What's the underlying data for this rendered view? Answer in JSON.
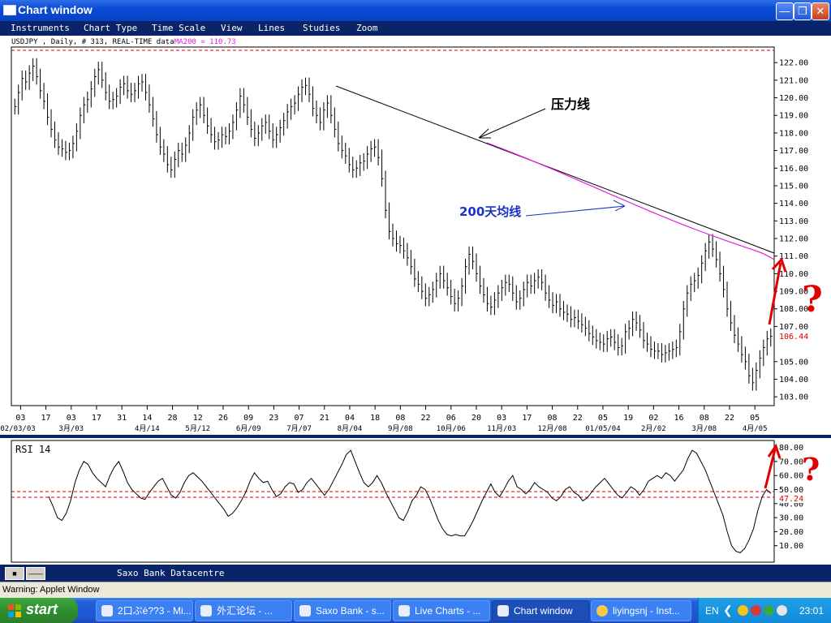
{
  "window": {
    "title": "Chart window"
  },
  "menu": [
    "Instruments",
    "Chart Type",
    "Time Scale",
    "View",
    "Lines",
    "Studies",
    "Zoom"
  ],
  "chart_header": {
    "info": "USDJPY , Daily, # 313, REAL-TIME data",
    "ma_label": ", MA200 = 110.73"
  },
  "annotations": {
    "resistance_line": "压力线",
    "ma200_label": "200天均线",
    "question_mark": "?"
  },
  "chart_data": [
    {
      "type": "line",
      "series": [
        {
          "name": "USDJPY",
          "values": [
            119.5,
            120.3,
            121.1,
            120.9,
            121.4,
            121.8,
            121.2,
            120.4,
            119.8,
            118.9,
            118.2,
            117.6,
            117.2,
            117.1,
            116.9,
            117.0,
            117.4,
            118.1,
            119.0,
            119.6,
            119.9,
            120.5,
            121.2,
            121.6,
            121.0,
            120.3,
            119.8,
            119.9,
            120.1,
            120.6,
            120.8,
            120.4,
            120.2,
            120.4,
            120.8,
            120.9,
            120.3,
            119.6,
            118.8,
            117.9,
            117.2,
            116.8,
            116.2,
            115.9,
            116.5,
            117.0,
            116.8,
            117.3,
            118.0,
            118.9,
            119.3,
            119.6,
            119.0,
            118.4,
            117.9,
            117.5,
            117.6,
            117.9,
            117.8,
            118.1,
            118.6,
            119.3,
            120.1,
            119.6,
            118.9,
            118.2,
            117.7,
            118.0,
            118.4,
            118.6,
            118.1,
            117.6,
            117.9,
            118.3,
            118.7,
            119.2,
            119.5,
            119.7,
            120.2,
            120.6,
            120.7,
            120.2,
            119.4,
            119.0,
            118.6,
            119.3,
            119.7,
            119.0,
            118.2,
            117.4,
            117.0,
            116.7,
            116.2,
            115.9,
            116.0,
            116.3,
            116.4,
            116.8,
            117.1,
            117.2,
            116.6,
            115.4,
            113.6,
            112.4,
            112.0,
            111.7,
            111.6,
            111.3,
            110.9,
            110.4,
            109.7,
            109.4,
            109.0,
            108.6,
            108.8,
            109.1,
            109.6,
            110.0,
            109.6,
            109.2,
            108.7,
            108.3,
            108.6,
            109.3,
            110.4,
            111.1,
            110.7,
            110.0,
            109.3,
            108.8,
            108.3,
            108.1,
            108.5,
            108.9,
            109.2,
            109.5,
            109.4,
            108.9,
            108.4,
            108.6,
            109.1,
            109.5,
            109.3,
            109.6,
            109.8,
            109.5,
            108.9,
            108.5,
            108.2,
            108.4,
            108.0,
            107.8,
            107.7,
            107.4,
            107.5,
            107.3,
            107.1,
            106.9,
            106.6,
            106.4,
            106.2,
            106.1,
            106.0,
            106.3,
            106.4,
            106.1,
            105.8,
            105.9,
            106.7,
            106.9,
            107.4,
            107.2,
            106.8,
            106.2,
            106.0,
            105.7,
            105.6,
            105.6,
            105.4,
            105.5,
            105.6,
            105.7,
            105.8,
            106.7,
            108.0,
            108.9,
            109.4,
            109.6,
            109.9,
            110.6,
            111.3,
            111.8,
            111.4,
            110.8,
            110.0,
            109.1,
            108.0,
            107.2,
            106.5,
            106.0,
            105.4,
            105.0,
            104.2,
            103.8,
            104.5,
            105.2,
            105.8,
            106.3,
            106.44
          ]
        }
      ],
      "ylim": [
        102.5,
        122.7
      ],
      "y_ticks": [
        "122.00",
        "121.00",
        "120.00",
        "119.00",
        "118.00",
        "117.00",
        "116.00",
        "115.00",
        "114.00",
        "113.00",
        "112.00",
        "111.00",
        "110.00",
        "109.00",
        "108.00",
        "107.00",
        "106.44",
        "105.00",
        "104.00",
        "103.00"
      ],
      "x_ticks_top": [
        "03",
        "17",
        "03",
        "17",
        "31",
        "14",
        "28",
        "12",
        "26",
        "09",
        "23",
        "07",
        "21",
        "04",
        "18",
        "08",
        "22",
        "06",
        "20",
        "03",
        "17",
        "08",
        "22",
        "05",
        "19",
        "02",
        "16",
        "08",
        "22",
        "05"
      ],
      "x_ticks_bottom": [
        "02/03/03",
        "3月/03",
        "4月/14",
        "5月/12",
        "6月/09",
        "7月/07",
        "8月/04",
        "9月/08",
        "10月/06",
        "11月/03",
        "12月/08",
        "01/05/04",
        "2月/02",
        "3月/08",
        "4月/05"
      ],
      "last_value": "106.44"
    },
    {
      "type": "line",
      "title": "RSI 14",
      "series": [
        {
          "name": "RSI 14",
          "values": [
            45,
            38,
            30,
            28,
            33,
            42,
            55,
            64,
            70,
            68,
            62,
            58,
            55,
            52,
            60,
            66,
            70,
            63,
            55,
            50,
            47,
            44,
            43,
            48,
            52,
            56,
            58,
            52,
            46,
            44,
            48,
            55,
            60,
            62,
            59,
            56,
            52,
            48,
            44,
            40,
            36,
            31,
            33,
            37,
            42,
            48,
            56,
            62,
            58,
            55,
            56,
            50,
            45,
            47,
            52,
            55,
            54,
            48,
            50,
            55,
            58,
            54,
            50,
            46,
            50,
            56,
            62,
            68,
            75,
            78,
            70,
            62,
            55,
            52,
            55,
            60,
            55,
            48,
            42,
            36,
            30,
            28,
            34,
            42,
            46,
            52,
            50,
            44,
            36,
            28,
            22,
            18,
            17,
            18,
            17,
            17,
            22,
            28,
            35,
            42,
            48,
            54,
            48,
            45,
            50,
            56,
            60,
            52,
            50,
            47,
            50,
            55,
            52,
            50,
            48,
            44,
            42,
            45,
            50,
            52,
            48,
            46,
            42,
            44,
            48,
            52,
            55,
            58,
            54,
            50,
            46,
            44,
            48,
            52,
            50,
            46,
            50,
            56,
            58,
            60,
            58,
            62,
            60,
            56,
            60,
            64,
            72,
            78,
            76,
            70,
            64,
            56,
            48,
            40,
            32,
            20,
            10,
            6,
            5,
            8,
            14,
            22,
            35,
            45,
            50,
            47.24
          ]
        }
      ],
      "ylim": [
        0,
        85
      ],
      "y_ticks": [
        "80.00",
        "70.00",
        "60.00",
        "50.00",
        "40.00",
        "30.00",
        "20.00",
        "10.00"
      ],
      "last_value": "47.24"
    }
  ],
  "status": {
    "source": "Saxo Bank Datacentre",
    "warning": "Warning: Applet Window"
  },
  "taskbar": {
    "start": "start",
    "items": [
      "2口ぷè??3 - Mi...",
      "外汇论坛 - ...",
      "Saxo Bank - s...",
      "Live Charts - ...",
      "Chart window",
      "liyingsnj - Inst..."
    ],
    "lang": "EN",
    "clock": "23:01"
  },
  "colors": {
    "accent": "#0a246a",
    "ma": "#e020e0",
    "arrow_red": "#e00000",
    "annotation_blue": "#1a32c8"
  }
}
